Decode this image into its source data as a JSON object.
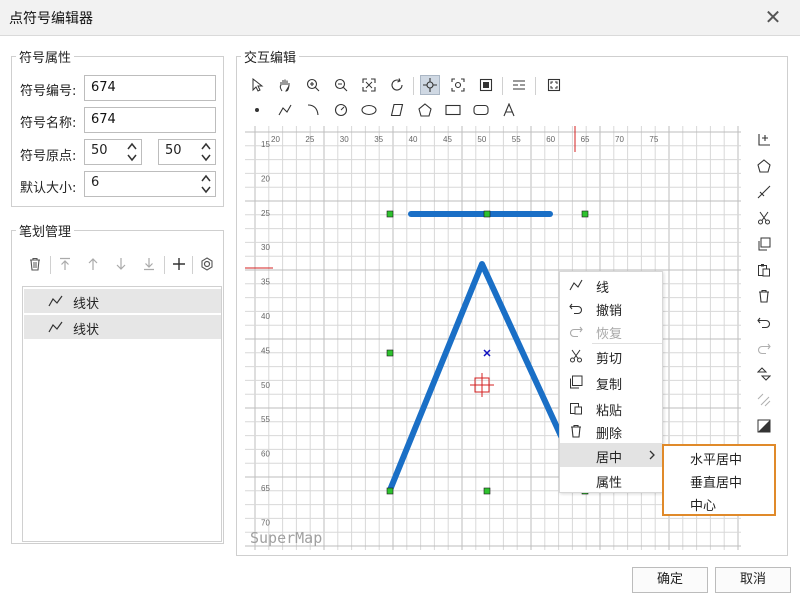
{
  "window": {
    "title": "点符号编辑器"
  },
  "symbol_props": {
    "group_title": "符号属性",
    "id_label": "符号编号:",
    "id_value": "674",
    "name_label": "符号名称:",
    "name_value": "674",
    "origin_label": "符号原点:",
    "origin_x": "50",
    "origin_y": "50",
    "size_label": "默认大小:",
    "size_value": "6"
  },
  "strokes": {
    "group_title": "笔划管理",
    "items": [
      {
        "label": "线状"
      },
      {
        "label": "线状"
      }
    ]
  },
  "editor": {
    "group_title": "交互编辑",
    "x_ticks": [
      "20",
      "25",
      "30",
      "35",
      "40",
      "45",
      "50",
      "55",
      "60",
      "65",
      "70",
      "75"
    ],
    "y_ticks": [
      "15",
      "20",
      "25",
      "30",
      "35",
      "40",
      "45",
      "50",
      "55",
      "60",
      "65",
      "70"
    ],
    "watermark": "SuperMap",
    "stroke_color": "#1a6fc6"
  },
  "context_menu": {
    "items": [
      {
        "label": "线",
        "icon": "polyline-icon"
      },
      {
        "label": "撤销",
        "icon": "undo-icon"
      },
      {
        "label": "恢复",
        "icon": "redo-icon"
      },
      {
        "label": "剪切",
        "icon": "scissors-icon"
      },
      {
        "label": "复制",
        "icon": "copy-icon"
      },
      {
        "label": "粘贴",
        "icon": "paste-icon"
      },
      {
        "label": "删除",
        "icon": "trash-icon"
      },
      {
        "label": "居中",
        "icon": ""
      },
      {
        "label": "属性",
        "icon": ""
      }
    ],
    "submenu": [
      {
        "label": "水平居中"
      },
      {
        "label": "垂直居中"
      },
      {
        "label": "中心"
      }
    ],
    "accent_color": "#e08a2a"
  },
  "buttons": {
    "ok": "确定",
    "cancel": "取消"
  }
}
